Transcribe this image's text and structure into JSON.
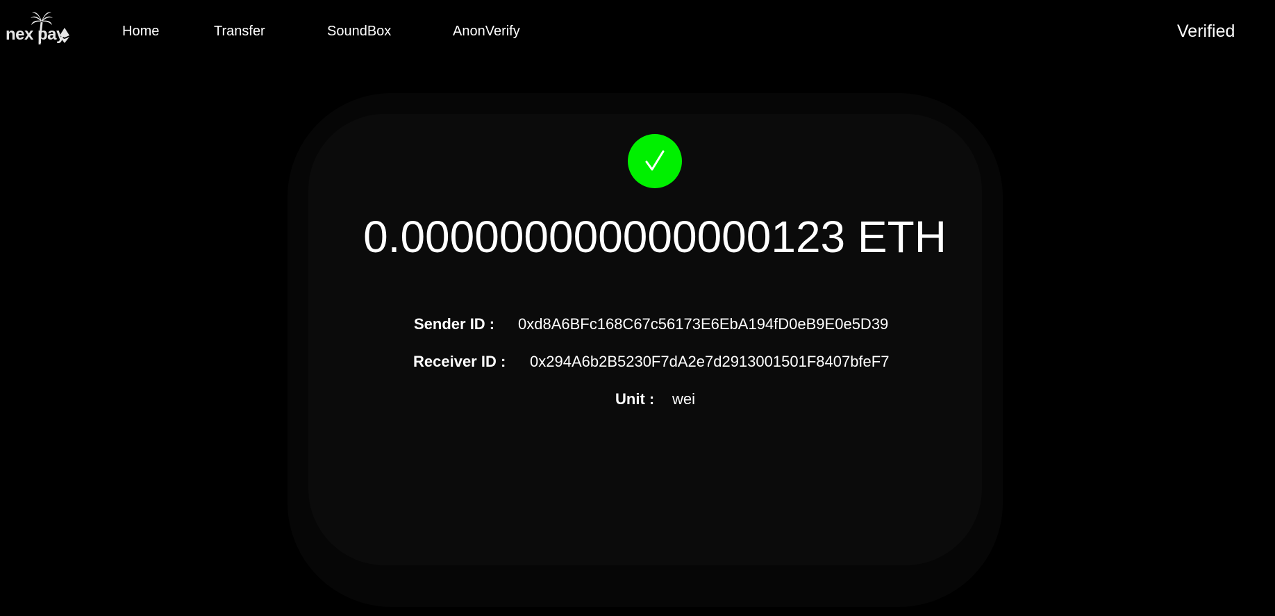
{
  "brand": {
    "logo_text": "nex pay",
    "icons": [
      "palm-tree-icon",
      "ethereum-icon"
    ]
  },
  "nav": {
    "links": [
      "Home",
      "Transfer",
      "SoundBox",
      "AnonVerify"
    ],
    "status": "Verified"
  },
  "receipt": {
    "status_icon": "check-icon",
    "status_color": "#00f000",
    "amount": "0.000000000000000123 ETH",
    "sender_label": "Sender ID :",
    "sender_value": "0xd8A6BFc168C67c56173E6EbA194fD0eB9E0e5D39",
    "receiver_label": "Receiver ID :",
    "receiver_value": "0x294A6b2B5230F7dA2e7d2913001501F8407bfeF7",
    "unit_label": "Unit :",
    "unit_value": "wei"
  }
}
